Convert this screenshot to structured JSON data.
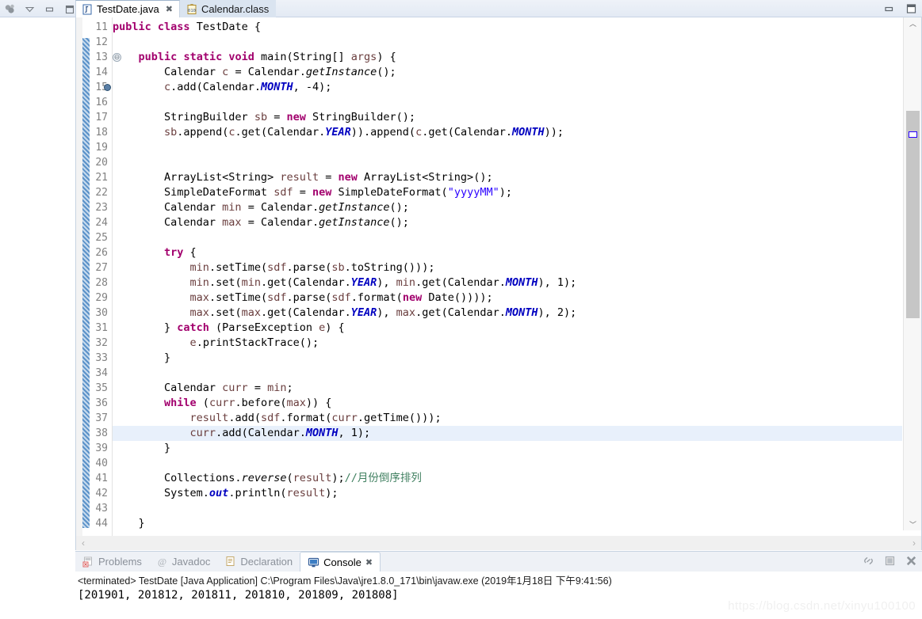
{
  "window": {
    "minimize_label": "▭",
    "maximize_label": "❐"
  },
  "view_toolbar": {
    "view_menu_icon": "view-menu-icon",
    "chevron_label": "▽",
    "minimize_label": "▭",
    "maximize_label": "❐"
  },
  "editor_tabs": [
    {
      "label": "TestDate.java",
      "icon": "java-file-icon",
      "active": true,
      "close_glyph": "✖"
    },
    {
      "label": "Calendar.class",
      "icon": "class-file-icon",
      "active": false,
      "close_glyph": ""
    }
  ],
  "editor": {
    "first_line": 11,
    "highlight_line": 38,
    "fold_marker_line": 13,
    "breakpoint_line": 15,
    "fold_glyph": "⊖",
    "lines": [
      {
        "n": 11,
        "html": "<span class=\"kw\">public</span> <span class=\"kw\">class</span> TestDate {"
      },
      {
        "n": 12,
        "html": ""
      },
      {
        "n": 13,
        "html": "    <span class=\"kw\">public</span> <span class=\"kw\">static</span> <span class=\"kw\">void</span> main(String[] <span class=\"lvar\">args</span>) {"
      },
      {
        "n": 14,
        "html": "        Calendar <span class=\"lvar\">c</span> = Calendar.<span class=\"mth\">getInstance</span>();"
      },
      {
        "n": 15,
        "html": "        <span class=\"lvar\">c</span>.add(Calendar.<span class=\"stat\">MONTH</span>, -4);"
      },
      {
        "n": 16,
        "html": ""
      },
      {
        "n": 17,
        "html": "        StringBuilder <span class=\"lvar\">sb</span> = <span class=\"kw\">new</span> StringBuilder();"
      },
      {
        "n": 18,
        "html": "        <span class=\"lvar\">sb</span>.append(<span class=\"lvar\">c</span>.get(Calendar.<span class=\"stat\">YEAR</span>)).append(<span class=\"lvar\">c</span>.get(Calendar.<span class=\"stat\">MONTH</span>));"
      },
      {
        "n": 19,
        "html": ""
      },
      {
        "n": 20,
        "html": ""
      },
      {
        "n": 21,
        "html": "        ArrayList&lt;String&gt; <span class=\"lvar\">result</span> = <span class=\"kw\">new</span> ArrayList&lt;String&gt;();"
      },
      {
        "n": 22,
        "html": "        SimpleDateFormat <span class=\"lvar\">sdf</span> = <span class=\"kw\">new</span> SimpleDateFormat(<span class=\"str\">\"yyyyMM\"</span>);"
      },
      {
        "n": 23,
        "html": "        Calendar <span class=\"lvar\">min</span> = Calendar.<span class=\"mth\">getInstance</span>();"
      },
      {
        "n": 24,
        "html": "        Calendar <span class=\"lvar\">max</span> = Calendar.<span class=\"mth\">getInstance</span>();"
      },
      {
        "n": 25,
        "html": ""
      },
      {
        "n": 26,
        "html": "        <span class=\"kw\">try</span> {"
      },
      {
        "n": 27,
        "html": "            <span class=\"lvar\">min</span>.setTime(<span class=\"lvar\">sdf</span>.parse(<span class=\"lvar\">sb</span>.toString()));"
      },
      {
        "n": 28,
        "html": "            <span class=\"lvar\">min</span>.set(<span class=\"lvar\">min</span>.get(Calendar.<span class=\"stat\">YEAR</span>), <span class=\"lvar\">min</span>.get(Calendar.<span class=\"stat\">MONTH</span>), 1);"
      },
      {
        "n": 29,
        "html": "            <span class=\"lvar\">max</span>.setTime(<span class=\"lvar\">sdf</span>.parse(<span class=\"lvar\">sdf</span>.format(<span class=\"kw\">new</span> Date())));"
      },
      {
        "n": 30,
        "html": "            <span class=\"lvar\">max</span>.set(<span class=\"lvar\">max</span>.get(Calendar.<span class=\"stat\">YEAR</span>), <span class=\"lvar\">max</span>.get(Calendar.<span class=\"stat\">MONTH</span>), 2);"
      },
      {
        "n": 31,
        "html": "        } <span class=\"kw\">catch</span> (ParseException <span class=\"lvar\">e</span>) {"
      },
      {
        "n": 32,
        "html": "            <span class=\"lvar\">e</span>.printStackTrace();"
      },
      {
        "n": 33,
        "html": "        }"
      },
      {
        "n": 34,
        "html": ""
      },
      {
        "n": 35,
        "html": "        Calendar <span class=\"lvar\">curr</span> = <span class=\"lvar\">min</span>;"
      },
      {
        "n": 36,
        "html": "        <span class=\"kw\">while</span> (<span class=\"lvar\">curr</span>.before(<span class=\"lvar\">max</span>)) {"
      },
      {
        "n": 37,
        "html": "            <span class=\"lvar\">result</span>.add(<span class=\"lvar\">sdf</span>.format(<span class=\"lvar\">curr</span>.getTime()));"
      },
      {
        "n": 38,
        "html": "            <span class=\"lvar\">curr</span>.add(Calendar.<span class=\"stat\">MONTH</span>, 1);"
      },
      {
        "n": 39,
        "html": "        }"
      },
      {
        "n": 40,
        "html": ""
      },
      {
        "n": 41,
        "html": "        Collections.<span class=\"mth\">reverse</span>(<span class=\"lvar\">result</span>);<span class=\"cmt\">//月份倒序排列</span>"
      },
      {
        "n": 42,
        "html": "        System.<span class=\"stat\">out</span>.println(<span class=\"lvar\">result</span>);"
      },
      {
        "n": 43,
        "html": ""
      },
      {
        "n": 44,
        "html": "    }"
      }
    ]
  },
  "hscroll": {
    "left_glyph": "‹",
    "right_glyph": "›"
  },
  "overview": {
    "up_glyph": "︿",
    "down_glyph": "﹀"
  },
  "bottom_tabs": [
    {
      "label": "Problems",
      "icon": "problems-icon",
      "active": false,
      "close_glyph": ""
    },
    {
      "label": "Javadoc",
      "icon": "javadoc-icon",
      "active": false,
      "close_glyph": ""
    },
    {
      "label": "Declaration",
      "icon": "declaration-icon",
      "active": false,
      "close_glyph": ""
    },
    {
      "label": "Console",
      "icon": "console-icon",
      "active": true,
      "close_glyph": "✖"
    }
  ],
  "console_tools": {
    "pin_label": "pin-console-icon",
    "stop_label": "stop-icon",
    "close_label": "✖"
  },
  "console": {
    "header": "<terminated> TestDate [Java Application] C:\\Program Files\\Java\\jre1.8.0_171\\bin\\javaw.exe (2019年1月18日 下午9:41:56)",
    "output": "[201901, 201812, 201811, 201810, 201809, 201808]"
  },
  "watermark": "https://blog.csdn.net/xinyu100100",
  "colors": {
    "keyword": "#a2006d",
    "string": "#2a00ff",
    "comment": "#3f7f5f",
    "static_field": "#0000c0",
    "local_var": "#6a3e3e",
    "current_line_highlight": "#e8f0fb",
    "tab_active_bg": "#ffffff",
    "tab_inactive_bg": "#dae4f0"
  }
}
